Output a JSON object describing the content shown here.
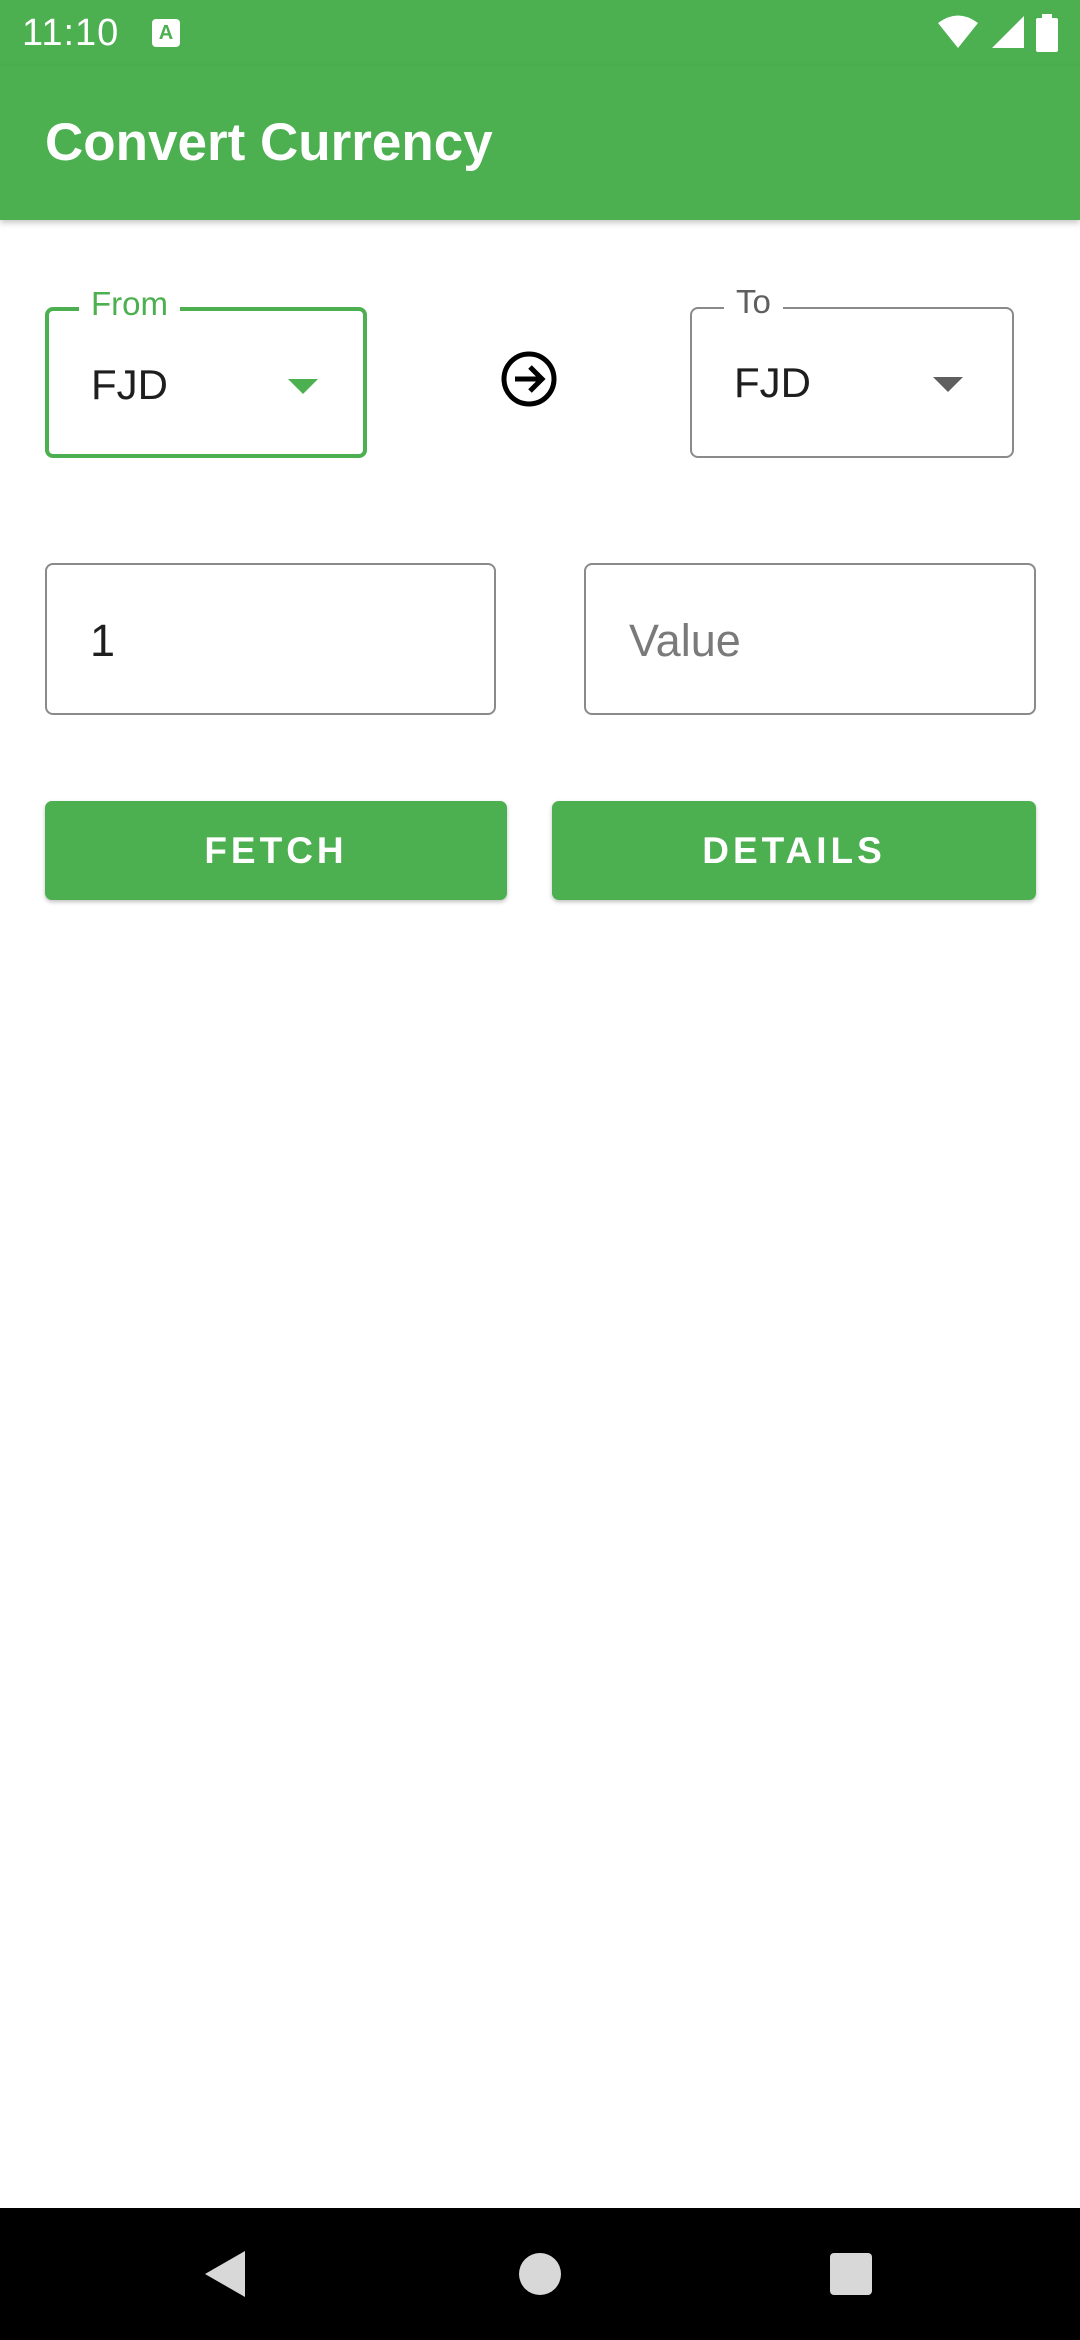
{
  "status_bar": {
    "time": "11:10",
    "notification_icon": "a-letter-icon",
    "notification_glyph": "A",
    "icons": [
      "wifi-icon",
      "signal-icon",
      "battery-icon"
    ]
  },
  "app_bar": {
    "title": "Convert Currency"
  },
  "converter": {
    "from": {
      "label": "From",
      "value": "FJD"
    },
    "to": {
      "label": "To",
      "value": "FJD"
    },
    "swap_icon": "arrow-right-circle-icon",
    "amount": {
      "value": "1"
    },
    "result": {
      "value": "",
      "placeholder": "Value"
    }
  },
  "buttons": {
    "fetch": "FETCH",
    "details": "DETAILS"
  },
  "nav_bar": {
    "icons": [
      "back-icon",
      "home-icon",
      "recents-icon"
    ]
  },
  "colors": {
    "primary": "#4CAF50",
    "text": "#1E1E1E",
    "border": "#8A8A8A",
    "nav": "#000000"
  }
}
